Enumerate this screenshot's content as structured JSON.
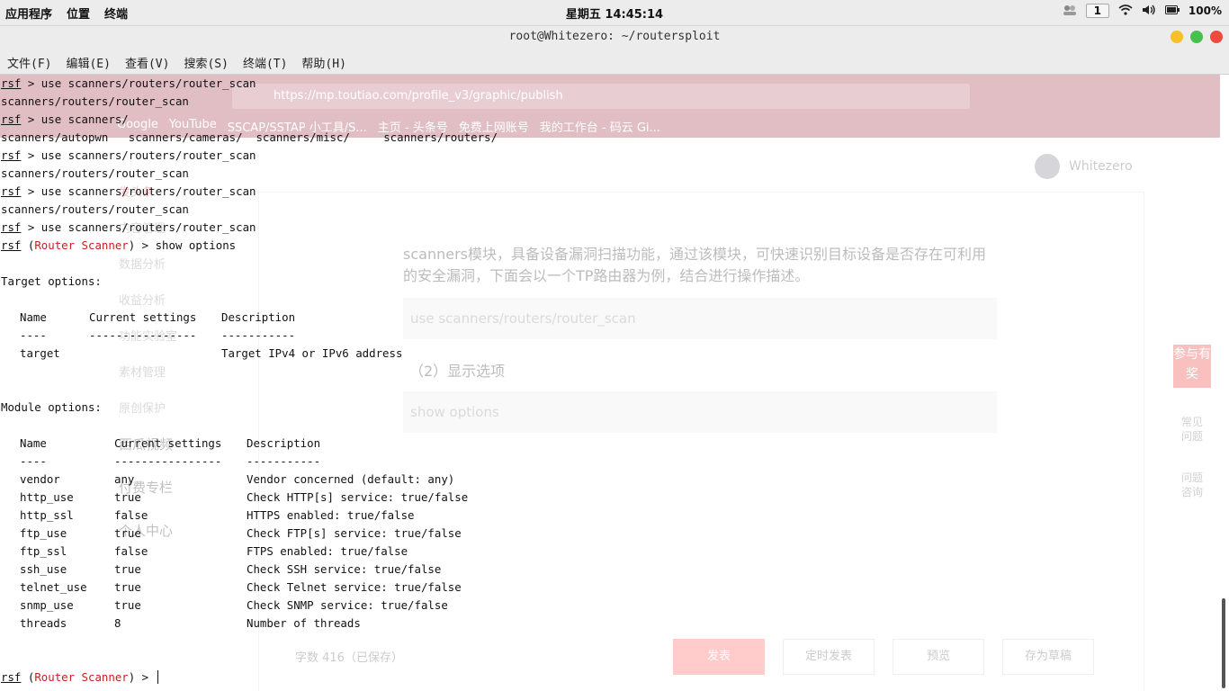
{
  "panel": {
    "apps_label": "应用程序",
    "places_label": "位置",
    "terminal_label": "终端",
    "clock": "星期五 14:45:14",
    "workspace": "1",
    "battery": "100%"
  },
  "window": {
    "title": "root@Whitezero: ~/routersploit"
  },
  "menu": {
    "file": "文件(F)",
    "edit": "编辑(E)",
    "view": "查看(V)",
    "search": "搜索(S)",
    "terminal": "终端(T)",
    "help": "帮助(H)"
  },
  "background": {
    "url": "https://mp.toutiao.com/profile_v3/graphic/publish",
    "bookmarks": [
      "Google",
      "YouTube",
      "SSCAP/SSTAP 小工具/S...",
      "主页 - 头条号",
      "免费上网账号",
      "我的工作台 - 码云 Gi..."
    ],
    "user": "Whitezero",
    "sidebar": [
      "发头条",
      "内容管理",
      "数据分析",
      "收益分析",
      "功能实验室",
      "素材管理",
      "原创保护"
    ],
    "sidebar_groups": [
      "西瓜视频",
      "付费专栏",
      "个人中心"
    ],
    "paragraph": "scanners模块，具备设备漏洞扫描功能，通过该模块，可快速识别目标设备是否存在可利用的安全漏洞，下面会以一个TP路由器为例，结合进行操作描述。",
    "code1": "use scanners/routers/router_scan",
    "heading": "（2）显示选项",
    "code2": "show options",
    "word_count": "字数 416（已保存）",
    "buttons": [
      "发表",
      "定时发表",
      "预览",
      "存为草稿"
    ],
    "side_tab": "参与有奖",
    "help1": "常见问题",
    "help2": "问题咨询"
  },
  "terminal": {
    "prompt": "rsf",
    "module_tag": "Router Scanner",
    "lines": {
      "l1": " > use scanners/routers/router_scan",
      "l2": "scanners/routers/router_scan",
      "l3": " > use scanners/",
      "l4": "scanners/autopwn   scanners/cameras/  scanners/misc/     scanners/routers/",
      "l5": " > use scanners/routers/router_scan",
      "l6": "scanners/routers/router_scan",
      "l7": " > use scanners/routers/router_scan",
      "l8": "scanners/routers/router_scan",
      "l9": " > use scanners/routers/router_scan",
      "l10_cmd": " > show options",
      "target_header": "Target options:",
      "module_header": "Module options:",
      "end_suffix": " > "
    },
    "target_table": {
      "headers": [
        "Name",
        "Current settings",
        "Description"
      ],
      "underlines": [
        "----",
        "----------------",
        "-----------"
      ],
      "rows": [
        [
          "target",
          "",
          "Target IPv4 or IPv6 address"
        ]
      ]
    },
    "module_table": {
      "headers": [
        "Name",
        "Current settings",
        "Description"
      ],
      "underlines": [
        "----",
        "----------------",
        "-----------"
      ],
      "rows": [
        [
          "vendor",
          "any",
          "Vendor concerned (default: any)"
        ],
        [
          "http_use",
          "true",
          "Check HTTP[s] service: true/false"
        ],
        [
          "http_ssl",
          "false",
          "HTTPS enabled: true/false"
        ],
        [
          "ftp_use",
          "true",
          "Check FTP[s] service: true/false"
        ],
        [
          "ftp_ssl",
          "false",
          "FTPS enabled: true/false"
        ],
        [
          "ssh_use",
          "true",
          "Check SSH service: true/false"
        ],
        [
          "telnet_use",
          "true",
          "Check Telnet service: true/false"
        ],
        [
          "snmp_use",
          "true",
          "Check SNMP service: true/false"
        ],
        [
          "threads",
          "8",
          "Number of threads"
        ]
      ]
    }
  }
}
